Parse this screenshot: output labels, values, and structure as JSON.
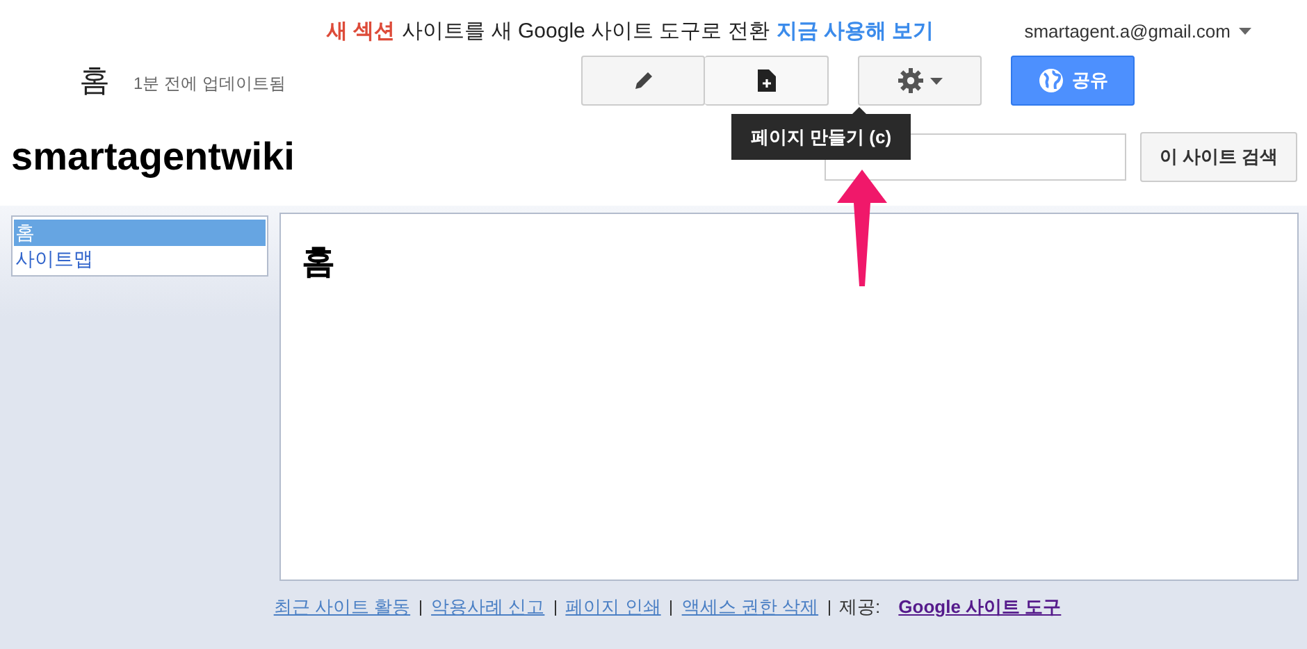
{
  "banner": [
    {
      "kind": "alert",
      "text": "새 섹션"
    },
    {
      "kind": "plain",
      "text": "사이트를 새 Google 사이트 도구로 전환"
    },
    {
      "kind": "link",
      "text": "지금 사용해 보기"
    }
  ],
  "account": {
    "email": "smartagent.a@gmail.com"
  },
  "page": {
    "title": "홈",
    "updated": "1분 전에 업데이트됨"
  },
  "toolbar": [
    {
      "kind": "edit"
    },
    {
      "kind": "new-page"
    },
    {
      "kind": "settings"
    },
    {
      "kind": "share",
      "label": "공유"
    }
  ],
  "tooltip": "페이지 만들기 (c)",
  "site_title": "smartagentwiki",
  "search": {
    "button": "이 사이트 검색"
  },
  "sidebar": {
    "items": [
      {
        "label": "홈",
        "selected": true
      },
      {
        "label": "사이트맵",
        "selected": false
      }
    ]
  },
  "content": {
    "heading": "홈"
  },
  "footer": {
    "links": [
      "최근 사이트 활동",
      "악용사례 신고",
      "페이지 인쇄",
      "액세스 권한 삭제"
    ],
    "provided_label": "제공:",
    "provided_link": "Google 사이트 도구"
  }
}
